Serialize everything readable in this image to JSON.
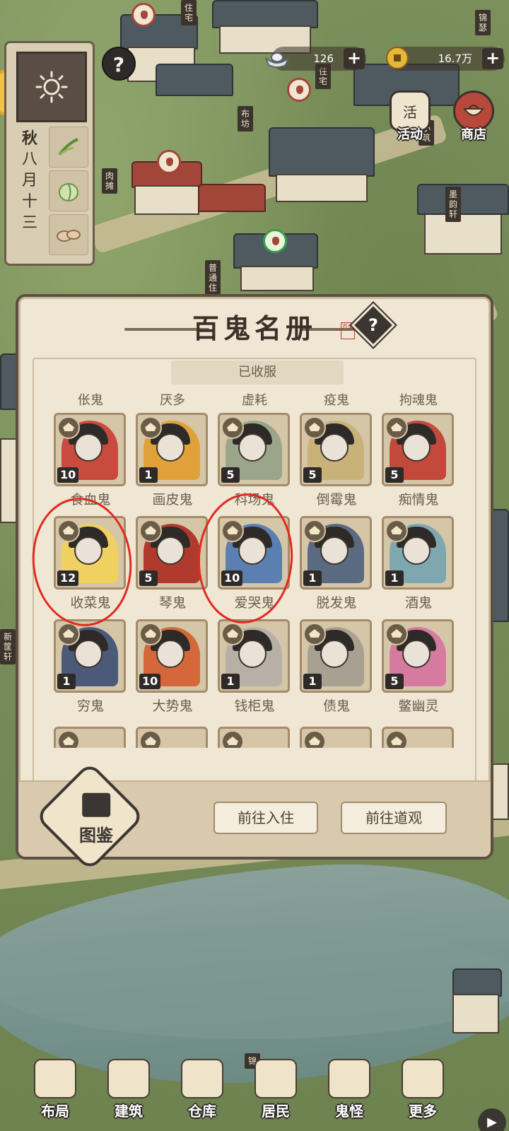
{
  "map": {
    "signposts": [
      "住宅",
      "住宅",
      "布坊",
      "肉摊",
      "普通住",
      "小筑",
      "墨韵轩",
      "锦瑟",
      "锦",
      "新筐轩"
    ]
  },
  "season": {
    "season": "秋",
    "date_chars": [
      "八",
      "月",
      "十",
      "三"
    ]
  },
  "currency": {
    "silver_value": "126",
    "coin_value": "16.7万",
    "plus": "+"
  },
  "top_buttons": {
    "event_icon_text": "活",
    "event_label": "活动",
    "shop_label": "商店"
  },
  "help_symbol": "?",
  "modal": {
    "title": "百鬼名册",
    "seal_text": "百鬼",
    "help_symbol": "?",
    "tab_label": "已收服",
    "top_row_names": [
      "伥鬼",
      "厌多",
      "虚耗",
      "疫鬼",
      "拘魂鬼"
    ],
    "cards": [
      {
        "name": "食血鬼",
        "level": "10",
        "tone": "#c94a3e"
      },
      {
        "name": "画皮鬼",
        "level": "1",
        "tone": "#e0a13a"
      },
      {
        "name": "科场鬼",
        "level": "5",
        "tone": "#9aa58a"
      },
      {
        "name": "倒霉鬼",
        "level": "5",
        "tone": "#c9b27a"
      },
      {
        "name": "痴情鬼",
        "level": "5",
        "tone": "#c4493d"
      },
      {
        "name": "收菜鬼",
        "level": "12",
        "tone": "#f0d060"
      },
      {
        "name": "琴鬼",
        "level": "5",
        "tone": "#b03a2e"
      },
      {
        "name": "爱哭鬼",
        "level": "10",
        "tone": "#5a7fb0"
      },
      {
        "name": "脱发鬼",
        "level": "1",
        "tone": "#5a6a80"
      },
      {
        "name": "酒鬼",
        "level": "1",
        "tone": "#7fa7b0"
      },
      {
        "name": "穷鬼",
        "level": "1",
        "tone": "#4b5a78"
      },
      {
        "name": "大势鬼",
        "level": "10",
        "tone": "#d4683a"
      },
      {
        "name": "钱柜鬼",
        "level": "1",
        "tone": "#b8b0a6"
      },
      {
        "name": "债鬼",
        "level": "1",
        "tone": "#a8a090"
      },
      {
        "name": "鳖幽灵",
        "level": "5",
        "tone": "#d77aa0"
      }
    ],
    "footer": {
      "codex_label": "图鉴",
      "move_in_button": "前往入住",
      "temple_button": "前往道观"
    }
  },
  "bottom_nav": [
    {
      "label": "布局",
      "icon": "layout-icon"
    },
    {
      "label": "建筑",
      "icon": "building-icon"
    },
    {
      "label": "仓库",
      "icon": "warehouse-icon"
    },
    {
      "label": "居民",
      "icon": "resident-icon"
    },
    {
      "label": "鬼怪",
      "icon": "ghost-icon"
    },
    {
      "label": "更多",
      "icon": "more-icon"
    }
  ],
  "colors": {
    "highlight_circle": "#e02a1f",
    "panel_border": "#5b4f43",
    "panel_bg": "#efe6d3"
  }
}
